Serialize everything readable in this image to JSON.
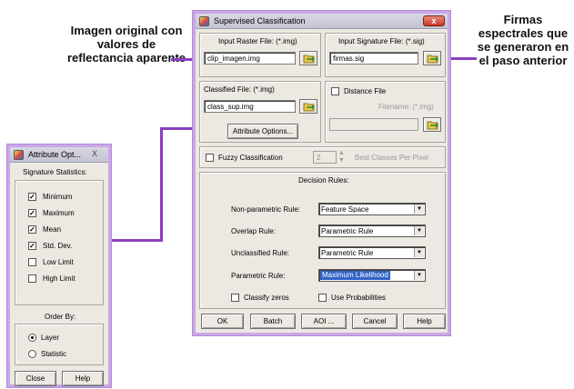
{
  "annotations": {
    "left": "Imagen original con valores de reflectancia aparente",
    "right": "Firmas espectrales que se generaron en el paso anterior"
  },
  "main_dialog": {
    "title": "Supervised Classification",
    "close": "x",
    "input_raster": {
      "label": "Input Raster File: (*.img)",
      "value": "clip_imagen.img"
    },
    "input_signature": {
      "label": "Input Signature File: (*.sig)",
      "value": "firmas.sig"
    },
    "classified": {
      "label": "Classified File: (*.img)",
      "value": "class_sup.img"
    },
    "attribute_options_button": "Attribute Options...",
    "distance_file": {
      "label": "Distance File",
      "filename_label": "Filename: (*.img)",
      "value": ""
    },
    "fuzzy": {
      "label": "Fuzzy Classification",
      "value": "2",
      "best_classes_label": "Best Classes Per Pixel"
    },
    "decision_rules": {
      "title": "Decision Rules:",
      "rows": [
        {
          "label": "Non-parametric Rule:",
          "value": "Feature Space"
        },
        {
          "label": "Overlap Rule:",
          "value": "Parametric Rule"
        },
        {
          "label": "Unclassified Rule:",
          "value": "Parametric Rule"
        },
        {
          "label": "Parametric Rule:",
          "value": "Maximum Likelihood"
        }
      ],
      "classify_zeros": "Classify zeros",
      "use_probabilities": "Use Probabilities"
    },
    "buttons": {
      "ok": "OK",
      "batch": "Batch",
      "aoi": "AOI ...",
      "cancel": "Cancel",
      "help": "Help"
    }
  },
  "attr_dialog": {
    "title": "Attribute Opt...",
    "close": "X",
    "signature_statistics": "Signature Statistics:",
    "items": [
      {
        "label": "Minimum",
        "checked": "✓"
      },
      {
        "label": "Maximum",
        "checked": "✓"
      },
      {
        "label": "Mean",
        "checked": "✓"
      },
      {
        "label": "Std. Dev.",
        "checked": "✓"
      },
      {
        "label": "Low Limit",
        "checked": ""
      },
      {
        "label": "High Limit",
        "checked": ""
      }
    ],
    "order_by": "Order By:",
    "order_options": [
      "Layer",
      "Statistic"
    ],
    "close_button": "Close",
    "help_button": "Help"
  },
  "colors": {
    "arrow": "#8a3fbf",
    "dialog_border": "#c9a8e6",
    "selection": "#3164c8"
  }
}
